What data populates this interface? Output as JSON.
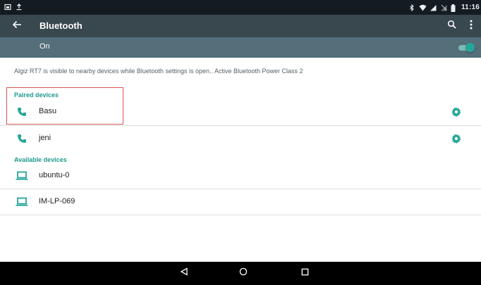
{
  "status_bar": {
    "time": "11:16",
    "icons": [
      "screenshot-icon",
      "upload-icon",
      "bluetooth-icon",
      "wifi-icon",
      "signal-icon",
      "no-sim-icon",
      "battery-icon"
    ]
  },
  "toolbar": {
    "title": "Bluetooth",
    "icons": [
      "back-arrow-icon",
      "search-icon",
      "overflow-menu-icon"
    ]
  },
  "bluetooth_switch": {
    "label": "On",
    "enabled": true
  },
  "visibility_message": "Algiz RT7 is visible to nearby devices while Bluetooth settings is open.. Active Bluetooth Power Class 2",
  "paired_devices": {
    "header": "Paired devices",
    "items": [
      {
        "name": "Basu",
        "icon": "phone-icon",
        "settings_icon": "gear-icon"
      },
      {
        "name": "jeni",
        "icon": "phone-icon",
        "settings_icon": "gear-icon"
      }
    ]
  },
  "available_devices": {
    "header": "Available devices",
    "items": [
      {
        "name": "ubuntu-0",
        "icon": "laptop-icon"
      },
      {
        "name": "IM-LP-069",
        "icon": "laptop-icon"
      }
    ]
  },
  "nav_bar": {
    "icons": [
      "back-triangle-icon",
      "home-circle-icon",
      "recents-square-icon"
    ]
  },
  "colors": {
    "status_bar": "#141b21",
    "toolbar": "#39474f",
    "switch_bar": "#546e7a",
    "accent": "#26a69a",
    "section_header": "#1e9a8c",
    "highlight": "#d9534f"
  }
}
